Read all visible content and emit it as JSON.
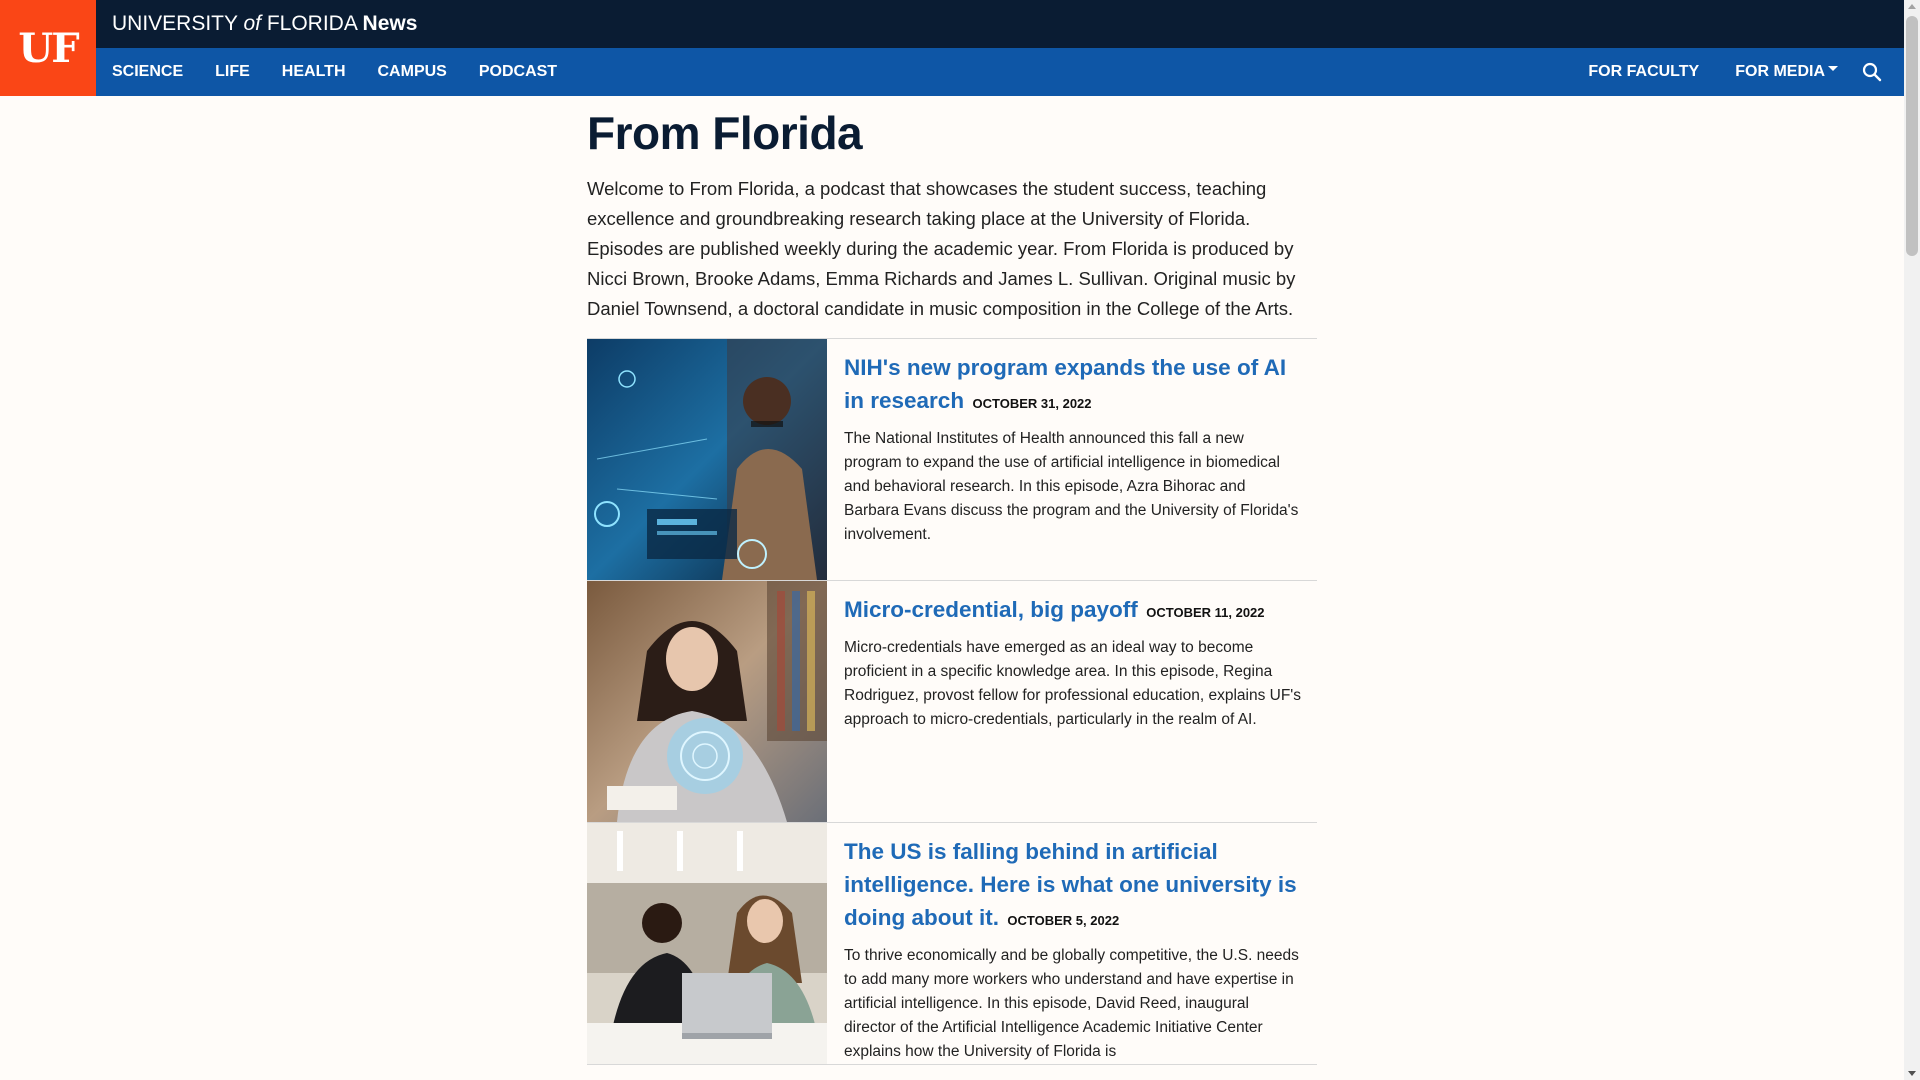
{
  "header": {
    "logo_text": "UF",
    "site_title_part1": "UNIVERSITY ",
    "site_title_of": "of",
    "site_title_part2": " FLORIDA ",
    "site_title_news": "News"
  },
  "nav": {
    "left": [
      "SCIENCE",
      "LIFE",
      "HEALTH",
      "CAMPUS",
      "PODCAST"
    ],
    "right": [
      "FOR FACULTY",
      "FOR MEDIA"
    ],
    "search_icon": "search-icon"
  },
  "colors": {
    "brand_orange": "#fa4616",
    "top_bar_navy": "#0a1c33",
    "nav_blue": "#0e56a6",
    "link_blue": "#1f6ab7",
    "page_bg": "#fffcf9"
  },
  "page": {
    "title": "From Florida",
    "intro": "Welcome to From Florida, a podcast that showcases the student success, teaching excellence and groundbreaking research taking place at the University of Florida. Episodes are published weekly during the academic year. From Florida is produced by Nicci Brown, Brooke Adams, Emma Richards and James L. Sullivan. Original music by Daniel Townsend, a doctoral candidate in music composition in the College of the Arts."
  },
  "episodes": [
    {
      "title": "NIH's new program expands the use of AI in research",
      "date": "OCTOBER 31, 2022",
      "summary": "The National Institutes of Health announced this fall a new program to expand the use of artificial intelligence in biomedical and behavioral research. In this episode, Azra Bihorac and Barbara Evans discuss the program and the University of Florida's involvement."
    },
    {
      "title": "Micro-credential, big payoff",
      "date": "OCTOBER 11, 2022",
      "summary": "Micro-credentials have emerged as an ideal way to become proficient in a specific knowledge area. In this episode, Regina Rodriguez, provost fellow for professional education, explains UF's approach to micro-credentials, particularly in the realm of AI."
    },
    {
      "title": "The US is falling behind in artificial intelligence. Here is what one university is doing about it.",
      "date": "OCTOBER 5, 2022",
      "summary": "To thrive economically and be globally competitive, the U.S. needs to add many more workers who understand and have expertise in artificial intelligence. In this episode, David Reed, inaugural director of the Artificial Intelligence Academic Initiative Center explains how the University of Florida is"
    }
  ]
}
